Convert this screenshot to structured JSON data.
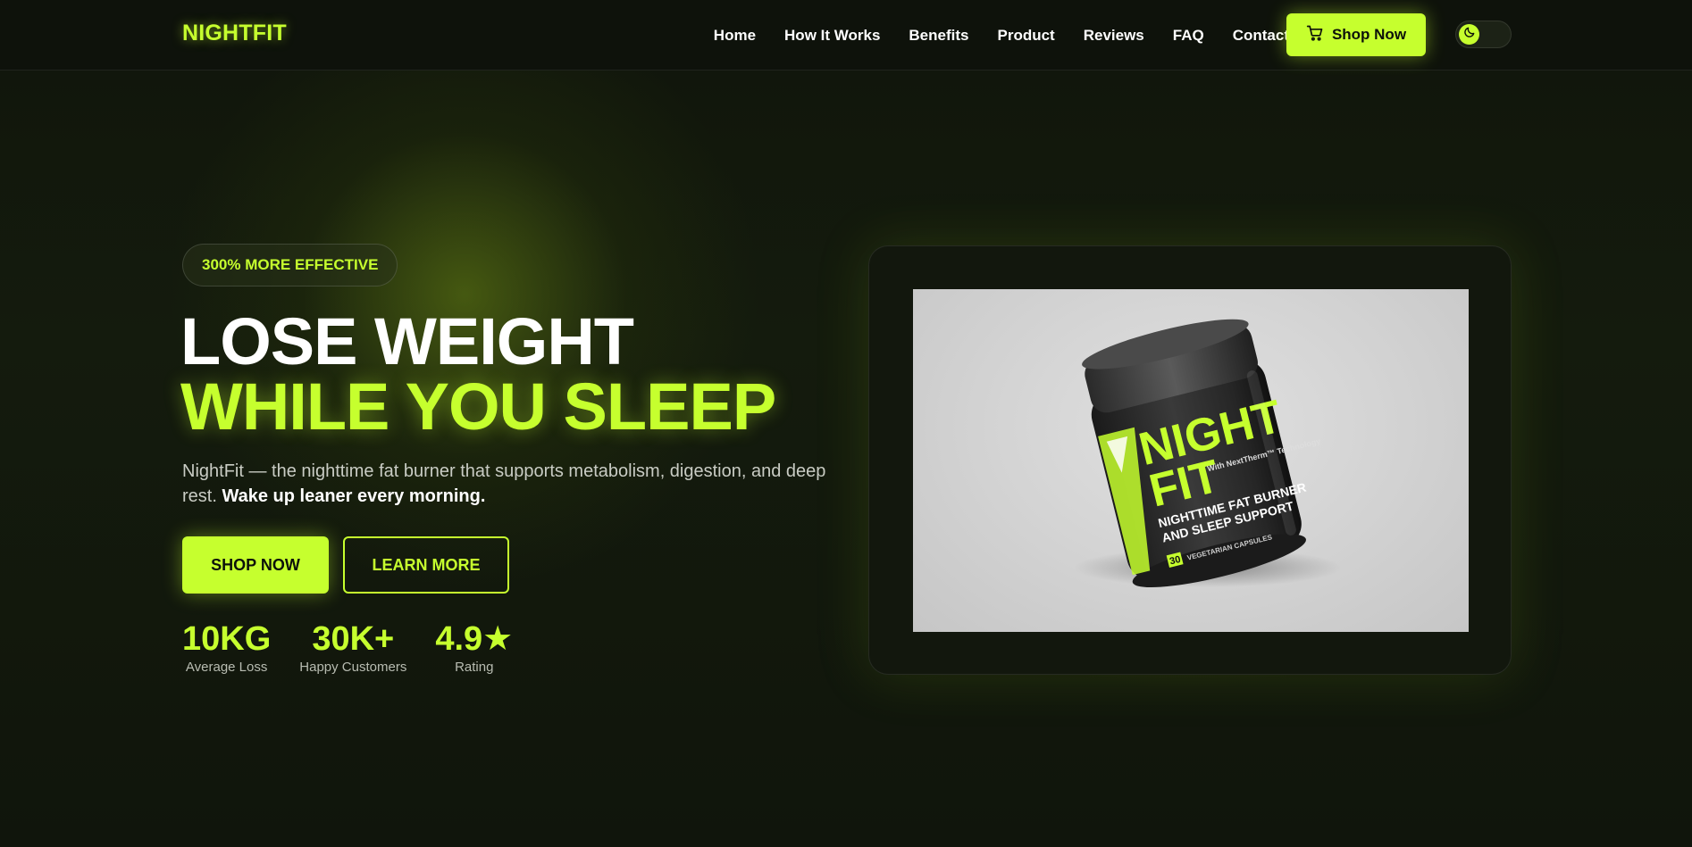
{
  "brand": {
    "logo": "NIGHTFIT"
  },
  "nav": {
    "links": [
      "Home",
      "How It Works",
      "Benefits",
      "Product",
      "Reviews",
      "FAQ",
      "Contact"
    ],
    "shop_label": "Shop Now"
  },
  "hero": {
    "badge": "300% MORE EFFECTIVE",
    "headline_line1": "LOSE WEIGHT",
    "headline_line2": "WHILE YOU SLEEP",
    "subtext": "NightFit — the nighttime fat burner that supports metabolism, digestion, and deep rest.",
    "subtext_bold": "Wake up leaner every morning.",
    "cta_primary": "SHOP NOW",
    "cta_secondary": "LEARN MORE",
    "stats": [
      {
        "value": "10KG",
        "label": "Average Loss"
      },
      {
        "value": "30K+",
        "label": "Happy Customers"
      },
      {
        "value": "4.9★",
        "label": "Rating"
      }
    ]
  },
  "product": {
    "label_brand_line1": "NIGHT",
    "label_brand_line2": "FIT",
    "label_tech": "With NextTherm™ Technology",
    "label_desc_line1": "NIGHTTIME FAT BURNER",
    "label_desc_line2": "AND SLEEP SUPPORT",
    "label_count": "30",
    "label_capsules": "VEGETARIAN CAPSULES"
  },
  "colors": {
    "accent": "#c6ff2e",
    "background": "#0d110a"
  },
  "icons": {
    "cart": "cart-icon",
    "theme": "moon-icon"
  }
}
